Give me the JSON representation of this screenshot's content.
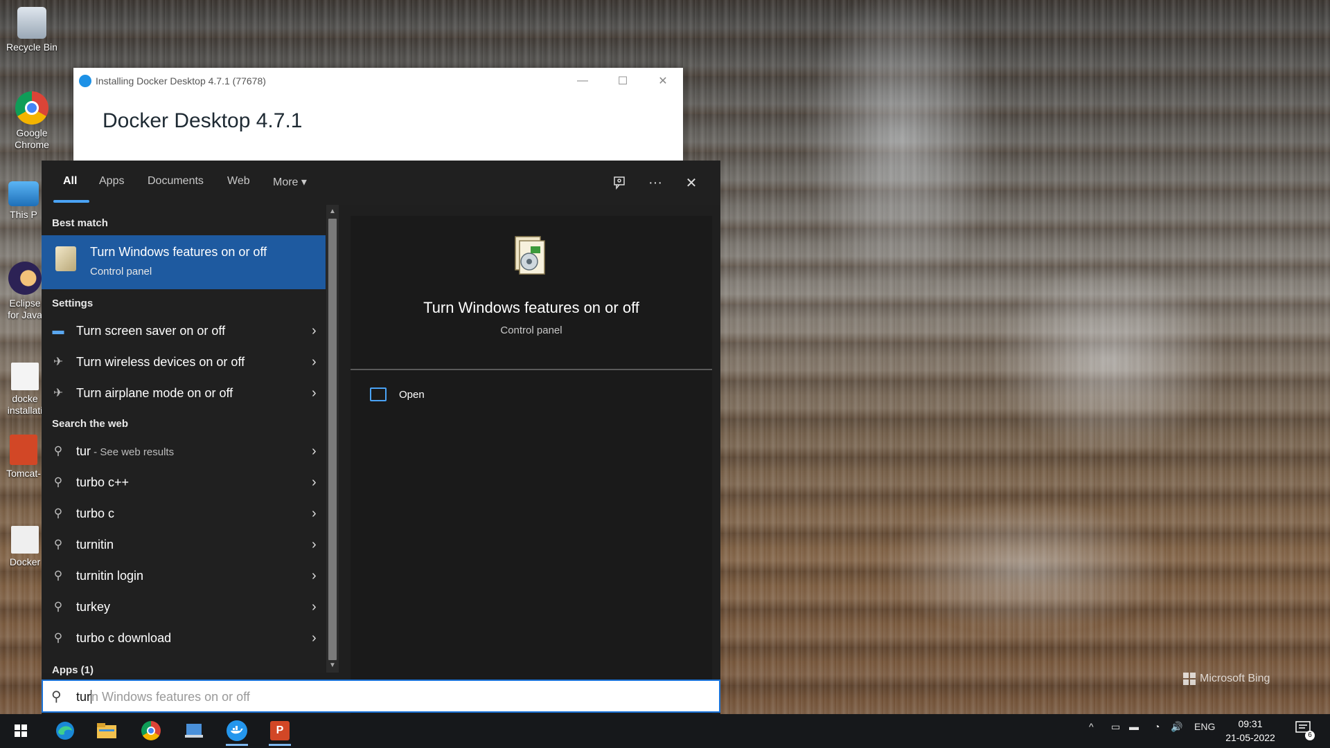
{
  "desktop": {
    "icons": [
      {
        "label": "Recycle Bin",
        "icon": "recycle-bin-icon"
      },
      {
        "label": "Google Chrome",
        "icon": "chrome-icon"
      },
      {
        "label": "This P",
        "icon": "this-pc-icon"
      },
      {
        "label": "Eclipse for Java",
        "icon": "eclipse-icon"
      },
      {
        "label": "docke installati",
        "icon": "document-icon"
      },
      {
        "label": "Tomcat-",
        "icon": "powerpoint-icon"
      },
      {
        "label": "Docker",
        "icon": "document-icon"
      }
    ],
    "watermark": "Microsoft Bing"
  },
  "installer": {
    "title": "Installing Docker Desktop 4.7.1 (77678)",
    "heading": "Docker Desktop  4.7.1",
    "buttons": {
      "minimize": "—",
      "maximize": "☐",
      "close": "✕"
    }
  },
  "search": {
    "tabs": [
      {
        "label": "All",
        "active": true
      },
      {
        "label": "Apps"
      },
      {
        "label": "Documents"
      },
      {
        "label": "Web"
      },
      {
        "label": "More ▾"
      }
    ],
    "toolbar": {
      "feedback_icon": "feedback-icon",
      "more_icon": "ellipsis-icon",
      "close_icon": "close-icon",
      "more_glyph": "···",
      "close_glyph": "✕"
    },
    "best_match": {
      "header": "Best match",
      "title": "Turn Windows features on or off",
      "subtitle": "Control panel"
    },
    "settings": {
      "header": "Settings",
      "items": [
        {
          "label": "Turn screen saver on or off",
          "icon": "monitor-icon"
        },
        {
          "label": "Turn wireless devices on or off",
          "icon": "airplane-icon"
        },
        {
          "label": "Turn airplane mode on or off",
          "icon": "airplane-icon"
        }
      ]
    },
    "web": {
      "header": "Search the web",
      "first": {
        "query": "tur",
        "suffix": " - See web results"
      },
      "items": [
        "turbo c++",
        "turbo c",
        "turnitin",
        "turnitin login",
        "turkey",
        "turbo c download"
      ]
    },
    "apps_header": "Apps (1)",
    "preview": {
      "title": "Turn Windows features on or off",
      "subtitle": "Control panel",
      "open_label": "Open"
    },
    "query": {
      "typed": "tur",
      "completion": "n Windows features on or off"
    }
  },
  "taskbar": {
    "apps": [
      "windows-start-icon",
      "edge-icon",
      "file-explorer-icon",
      "chrome-icon",
      "docker-app-icon",
      "docker-whale-icon",
      "powerpoint-icon"
    ],
    "tray": {
      "chevron": "^",
      "lang": "ENG",
      "volume": "🔊"
    },
    "clock": {
      "time": "09:31",
      "date": "21-05-2022"
    },
    "notifications": "6"
  }
}
